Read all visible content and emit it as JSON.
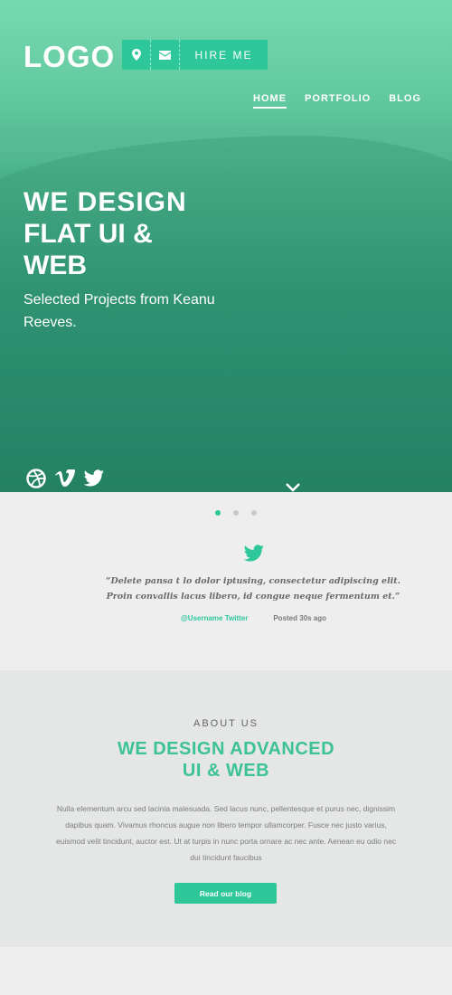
{
  "header": {
    "logo": "LOGO",
    "hire_label": "HIRE ME",
    "nav": [
      {
        "label": "HOME",
        "active": true
      },
      {
        "label": "PORTFOLIO",
        "active": false
      },
      {
        "label": "BLOG",
        "active": false
      }
    ]
  },
  "hero": {
    "line1": "WE DESIGN",
    "line2_bold": "FLAT UI",
    "line2_amp": " &",
    "line3": "WEB",
    "subtitle": "Selected Projects from Keanu Reeves."
  },
  "social": [
    "dribbble-icon",
    "vimeo-icon",
    "twitter-icon"
  ],
  "testimonial": {
    "quote": "“Delete pansa t lo dolor iptusing, consectetur adipiscing elit. Proin convallis lacus libero, id congue neque fermentum et.”",
    "user": "@Username Twitter",
    "time": "Posted 30s ago",
    "dots": 3,
    "active_dot": 0
  },
  "about": {
    "eyebrow": "ABOUT US",
    "title_line1": "WE DESIGN ADVANCED",
    "title_line2": "UI & WEB",
    "body": "Nulla elementum arcu sed lacinia malesuada. Sed lacus nunc, pellentesque et purus nec, dignissim dapibus quam. Vivamus rhoncus augue non libero tempor ullamcorper. Fusce nec justo varius, euismod velit tincidunt, auctor est. Ut at turpis in nunc porta ornare ac nec ante. Aenean eu odio nec dui tincidunt faucibus",
    "button": "Read our blog"
  },
  "colors": {
    "accent": "#2ec79a",
    "title": "#3dc393"
  }
}
